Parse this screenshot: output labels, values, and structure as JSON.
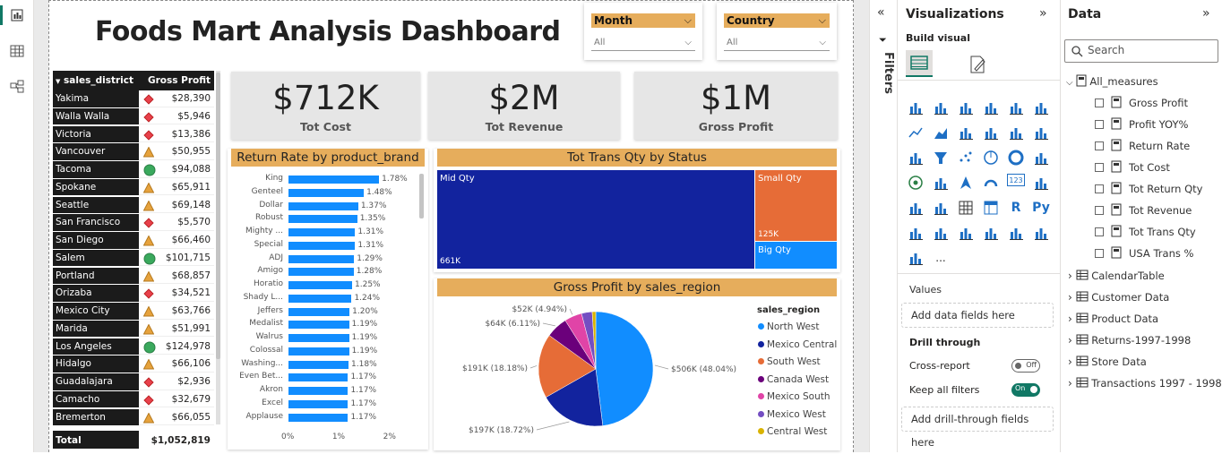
{
  "dashboard": {
    "title": "Foods Mart Analysis Dashboard"
  },
  "slicers": [
    {
      "label": "Month",
      "value": "All"
    },
    {
      "label": "Country",
      "value": "All"
    }
  ],
  "table": {
    "headers": [
      "sales_district",
      "Gross Profit"
    ],
    "rows": [
      {
        "district": "Yakima",
        "value": "$28,390",
        "status": "diamond"
      },
      {
        "district": "Walla Walla",
        "value": "$5,946",
        "status": "diamond"
      },
      {
        "district": "Victoria",
        "value": "$13,386",
        "status": "diamond"
      },
      {
        "district": "Vancouver",
        "value": "$50,955",
        "status": "triangle"
      },
      {
        "district": "Tacoma",
        "value": "$94,088",
        "status": "circle"
      },
      {
        "district": "Spokane",
        "value": "$65,911",
        "status": "triangle"
      },
      {
        "district": "Seattle",
        "value": "$69,148",
        "status": "triangle"
      },
      {
        "district": "San Francisco",
        "value": "$5,570",
        "status": "diamond"
      },
      {
        "district": "San Diego",
        "value": "$66,460",
        "status": "triangle"
      },
      {
        "district": "Salem",
        "value": "$101,715",
        "status": "circle"
      },
      {
        "district": "Portland",
        "value": "$68,857",
        "status": "triangle"
      },
      {
        "district": "Orizaba",
        "value": "$34,521",
        "status": "diamond"
      },
      {
        "district": "Mexico City",
        "value": "$63,766",
        "status": "triangle"
      },
      {
        "district": "Marida",
        "value": "$51,991",
        "status": "triangle"
      },
      {
        "district": "Los Angeles",
        "value": "$124,978",
        "status": "circle"
      },
      {
        "district": "Hidalgo",
        "value": "$66,106",
        "status": "triangle"
      },
      {
        "district": "Guadalajara",
        "value": "$2,936",
        "status": "diamond"
      },
      {
        "district": "Camacho",
        "value": "$32,679",
        "status": "diamond"
      },
      {
        "district": "Bremerton",
        "value": "$66,055",
        "status": "triangle"
      }
    ],
    "total_label": "Total",
    "total_value": "$1,052,819"
  },
  "cards": [
    {
      "value": "$712K",
      "label": "Tot Cost"
    },
    {
      "value": "$2M",
      "label": "Tot Revenue"
    },
    {
      "value": "$1M",
      "label": "Gross Profit"
    }
  ],
  "chart_data": [
    {
      "type": "bar",
      "title": "Return Rate by product_brand",
      "categories": [
        "King",
        "Genteel",
        "Dollar",
        "Robust",
        "Mighty ...",
        "Special",
        "ADJ",
        "Amigo",
        "Horatio",
        "Shady L...",
        "Jeffers",
        "Medalist",
        "Walrus",
        "Colossal",
        "Washing...",
        "Even Bet...",
        "Akron",
        "Excel",
        "Applause"
      ],
      "values": [
        1.78,
        1.48,
        1.37,
        1.35,
        1.31,
        1.31,
        1.29,
        1.28,
        1.25,
        1.24,
        1.2,
        1.19,
        1.19,
        1.19,
        1.18,
        1.17,
        1.17,
        1.17,
        1.17
      ],
      "labels": [
        "1.78%",
        "1.48%",
        "1.37%",
        "1.35%",
        "1.31%",
        "1.31%",
        "1.29%",
        "1.28%",
        "1.25%",
        "1.24%",
        "1.20%",
        "1.19%",
        "1.19%",
        "1.19%",
        "1.18%",
        "1.17%",
        "1.17%",
        "1.17%",
        "1.17%"
      ],
      "xticks": [
        "0%",
        "1%",
        "2%"
      ],
      "xlim": [
        0,
        2.2
      ],
      "color": "#118dff"
    },
    {
      "type": "treemap",
      "title": "Tot Trans Qty by Status",
      "categories": [
        "Mid Qty",
        "Small Qty",
        "Big Qty"
      ],
      "values": [
        661,
        125,
        40
      ],
      "value_labels": [
        "661K",
        "125K",
        ""
      ],
      "colors": [
        "#12239e",
        "#e66c37",
        "#118dff"
      ]
    },
    {
      "type": "pie",
      "title": "Gross Profit by sales_region",
      "legend_title": "sales_region",
      "categories": [
        "North West",
        "Mexico Central",
        "South West",
        "Canada West",
        "Mexico South",
        "Mexico West",
        "Central West"
      ],
      "values": [
        48.04,
        18.72,
        18.18,
        6.11,
        4.94,
        3.0,
        1.0
      ],
      "labels": [
        "$506K (48.04%)",
        "$197K (18.72%)",
        "$191K (18.18%)",
        "$64K (6.11%)",
        "$52K (4.94%)",
        "",
        ""
      ],
      "colors": [
        "#118dff",
        "#12239e",
        "#e66c37",
        "#6b007b",
        "#e044a7",
        "#744ec2",
        "#d9b300"
      ],
      "legend_position": "right"
    }
  ],
  "filters_pane": {
    "label": "Filters",
    "collapse": "«"
  },
  "viz_pane": {
    "title": "Visualizations",
    "expand": "»",
    "build": "Build visual",
    "values_label": "Values",
    "values_placeholder": "Add data fields here",
    "drill_label": "Drill through",
    "cross_report": "Cross-report",
    "cross_state": "Off",
    "keep_filters": "Keep all filters",
    "keep_state": "On",
    "drill_placeholder": "Add drill-through fields here",
    "icons": [
      "stacked-bar",
      "stacked-column",
      "clustered-bar",
      "clustered-column",
      "100-bar",
      "100-column",
      "line",
      "area",
      "stacked-area",
      "line-column",
      "line-clustered",
      "ribbon",
      "waterfall",
      "funnel",
      "scatter",
      "pie",
      "donut",
      "treemap",
      "map",
      "filled-map",
      "azure-map",
      "gauge",
      "card",
      "multirow-card",
      "kpi",
      "slicer",
      "table",
      "matrix",
      "r-visual",
      "python-visual",
      "key-influencers",
      "decomposition",
      "qa",
      "narrative",
      "goals",
      "paginated",
      "power-apps",
      "more"
    ],
    "r_label": "R",
    "py_label": "Py",
    "card_label": "123",
    "more_label": "..."
  },
  "data_pane": {
    "title": "Data",
    "expand": "»",
    "search_placeholder": "Search",
    "measures_group": "All_measures",
    "measures": [
      "Gross Profit",
      "Profit YOY%",
      "Return Rate",
      "Tot Cost",
      "Tot Return Qty",
      "Tot Revenue",
      "Tot Trans Qty",
      "USA Trans %"
    ],
    "tables": [
      "CalendarTable",
      "Customer Data",
      "Product Data",
      "Returns-1997-1998",
      "Store Data",
      "Transactions 1997 - 1998"
    ]
  }
}
